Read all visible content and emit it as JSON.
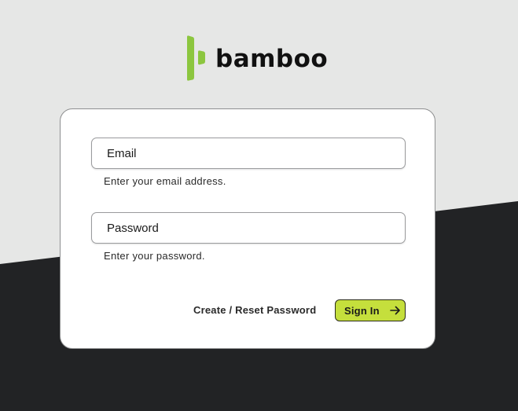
{
  "brand": {
    "name": "bamboo",
    "accent_color": "#8cc63f",
    "logo_icon": "bamboo-mark-icon"
  },
  "login": {
    "email": {
      "placeholder": "Email",
      "value": "",
      "help": "Enter your email address."
    },
    "password": {
      "placeholder": "Password",
      "value": "",
      "help": "Enter your password."
    },
    "reset_link_label": "Create / Reset Password",
    "submit_label": "Sign In",
    "submit_icon": "arrow-right-icon",
    "submit_color": "#c5df3c"
  },
  "colors": {
    "background_light": "#e6e7e6",
    "background_dark": "#222325",
    "card": "#ffffff"
  }
}
